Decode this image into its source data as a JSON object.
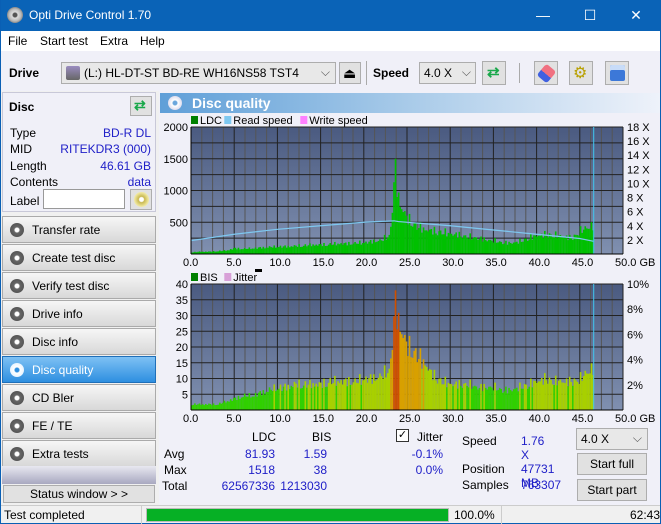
{
  "window": {
    "title": "Opti Drive Control 1.70",
    "minimize": "—",
    "maximize": "☐",
    "close": "✕"
  },
  "menu": [
    "File",
    "Start test",
    "Extra",
    "Help"
  ],
  "toolbar": {
    "drive_label": "Drive",
    "drive_value": "(L:)  HL-DT-ST BD-RE  WH16NS58 TST4",
    "speed_label": "Speed",
    "speed_value": "4.0 X",
    "icons": [
      "eject-icon",
      "refresh-icon",
      "eraser-icon",
      "settings-icon",
      "save-icon"
    ]
  },
  "disc": {
    "header": "Disc",
    "rows": [
      {
        "label": "Type",
        "value": "BD-R DL"
      },
      {
        "label": "MID",
        "value": "RITEKDR3 (000)"
      },
      {
        "label": "Length",
        "value": "46.61 GB"
      },
      {
        "label": "Contents",
        "value": "data"
      }
    ],
    "label_field_label": "Label",
    "label_field_value": ""
  },
  "nav": [
    {
      "label": "Transfer rate",
      "active": false
    },
    {
      "label": "Create test disc",
      "active": false
    },
    {
      "label": "Verify test disc",
      "active": false
    },
    {
      "label": "Drive info",
      "active": false
    },
    {
      "label": "Disc info",
      "active": false
    },
    {
      "label": "Disc quality",
      "active": true
    },
    {
      "label": "CD Bler",
      "active": false
    },
    {
      "label": "FE / TE",
      "active": false
    },
    {
      "label": "Extra tests",
      "active": false
    }
  ],
  "status_window_button": "Status window > >",
  "panel_title": "Disc quality",
  "stats": {
    "col_ldc": "LDC",
    "col_bis": "BIS",
    "jitter_label": "Jitter",
    "jitter_checked": true,
    "rows": [
      {
        "label": "Avg",
        "ldc": "81.93",
        "bis": "1.59",
        "jitter": "-0.1%"
      },
      {
        "label": "Max",
        "ldc": "1518",
        "bis": "38",
        "jitter": "0.0%"
      },
      {
        "label": "Total",
        "ldc": "62567336",
        "bis": "1213030",
        "jitter": ""
      }
    ],
    "speed_label": "Speed",
    "speed_value": "1.76 X",
    "position_label": "Position",
    "position_value": "47731 MB",
    "samples_label": "Samples",
    "samples_value": "763307",
    "speed_select": "4.0 X",
    "start_full": "Start full",
    "start_part": "Start part"
  },
  "statusbar": {
    "text": "Test completed",
    "progress_percent": 100.0,
    "progress_text": "100.0%",
    "time": "62:43"
  },
  "colors": {
    "ldc": "#00c000",
    "read_speed": "#7ec8f0",
    "write_speed": "#ff80ff",
    "bis": "#00a000",
    "jitter": "#d8a0d8",
    "accent": "#0a63b7",
    "progress": "#06b025"
  },
  "chart_data": [
    {
      "type": "area",
      "title": "LDC",
      "legend": [
        "LDC",
        "Read speed",
        "Write speed"
      ],
      "x_ticks": [
        "0.0",
        "5.0",
        "10.0",
        "15.0",
        "20.0",
        "25.0",
        "30.0",
        "35.0",
        "40.0",
        "45.0",
        "50.0 GB"
      ],
      "xlim": [
        0,
        50
      ],
      "ylim": [
        0,
        2000
      ],
      "y_ticks_left": [
        "500",
        "1000",
        "1500",
        "2000"
      ],
      "y_ticks_right": [
        "2 X",
        "4 X",
        "6 X",
        "8 X",
        "10 X",
        "12 X",
        "14 X",
        "16 X",
        "18 X"
      ],
      "y2lim": [
        0,
        18
      ],
      "series": [
        {
          "name": "LDC",
          "x": [
            0,
            1,
            2,
            3,
            4,
            5,
            6,
            7,
            8,
            9,
            10,
            11,
            12,
            13,
            14,
            15,
            16,
            17,
            18,
            19,
            20,
            21,
            22,
            23,
            23.5,
            24,
            25,
            26,
            27,
            28,
            29,
            30,
            31,
            32,
            33,
            34,
            35,
            36,
            37,
            38,
            39,
            40,
            41,
            42,
            43,
            44,
            45,
            46,
            46.6
          ],
          "y": [
            30,
            40,
            40,
            50,
            60,
            100,
            90,
            100,
            110,
            120,
            130,
            130,
            140,
            150,
            160,
            160,
            170,
            180,
            180,
            190,
            200,
            220,
            240,
            350,
            1500,
            900,
            600,
            500,
            420,
            400,
            380,
            350,
            330,
            300,
            280,
            250,
            230,
            200,
            190,
            220,
            280,
            320,
            340,
            330,
            300,
            280,
            400,
            480,
            500
          ]
        },
        {
          "name": "Read speed",
          "x": [
            0,
            5,
            10,
            15,
            20,
            23.5,
            24,
            30,
            35,
            40,
            45,
            46.6
          ],
          "y": [
            1.9,
            2.8,
            3.5,
            4.0,
            4.5,
            4.7,
            4.6,
            4.0,
            3.4,
            2.8,
            2.2,
            1.8
          ]
        }
      ]
    },
    {
      "type": "area",
      "title": "BIS",
      "legend": [
        "BIS",
        "Jitter"
      ],
      "x_ticks": [
        "0.0",
        "5.0",
        "10.0",
        "15.0",
        "20.0",
        "25.0",
        "30.0",
        "35.0",
        "40.0",
        "45.0",
        "50.0 GB"
      ],
      "xlim": [
        0,
        50
      ],
      "ylim": [
        0,
        40
      ],
      "y_ticks_left": [
        "5",
        "10",
        "15",
        "20",
        "25",
        "30",
        "35",
        "40"
      ],
      "y_ticks_right": [
        "2%",
        "4%",
        "6%",
        "8%",
        "10%"
      ],
      "y2lim": [
        0,
        10
      ],
      "series": [
        {
          "name": "BIS",
          "x": [
            0,
            1,
            2,
            3,
            4,
            5,
            6,
            7,
            8,
            9,
            10,
            11,
            12,
            13,
            14,
            15,
            16,
            17,
            18,
            19,
            20,
            21,
            22,
            23,
            23.5,
            24,
            25,
            26,
            27,
            28,
            29,
            30,
            31,
            32,
            33,
            34,
            35,
            36,
            37,
            38,
            39,
            40,
            41,
            42,
            43,
            44,
            45,
            46,
            46.6
          ],
          "y": [
            2,
            2,
            2,
            2,
            3,
            4,
            5,
            5,
            6,
            7,
            8,
            8,
            9,
            9,
            9,
            9,
            10,
            10,
            10,
            10,
            11,
            11,
            12,
            15,
            38,
            30,
            22,
            20,
            16,
            12,
            10,
            9,
            9,
            9,
            8,
            8,
            8,
            7,
            7,
            8,
            9,
            10,
            11,
            10,
            10,
            10,
            11,
            14,
            15
          ]
        }
      ]
    }
  ]
}
